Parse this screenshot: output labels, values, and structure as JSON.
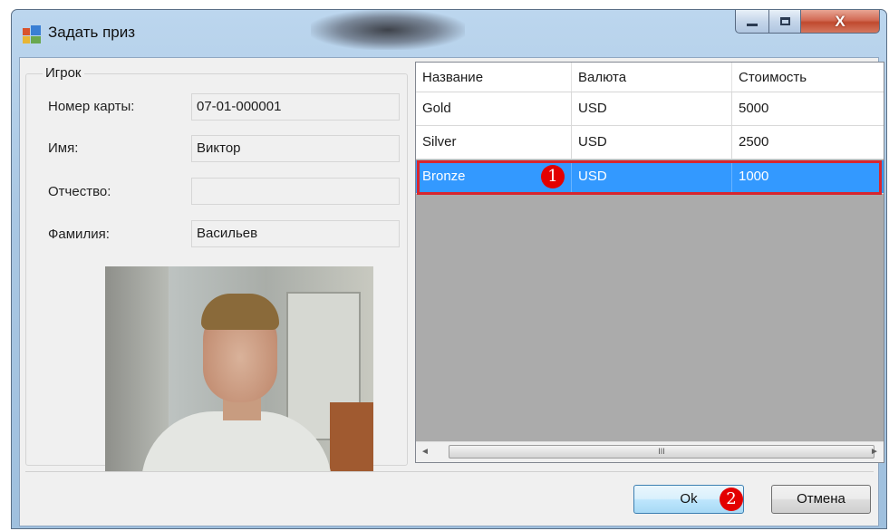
{
  "window": {
    "title": "Задать приз",
    "close_glyph": "X"
  },
  "player": {
    "group_title": "Игрок",
    "fields": [
      {
        "label": "Номер карты:",
        "value": "07-01-000001"
      },
      {
        "label": "Имя:",
        "value": "Виктор"
      },
      {
        "label": "Отчество:",
        "value": ""
      },
      {
        "label": "Фамилия:",
        "value": "Васильев"
      }
    ]
  },
  "prizes": {
    "columns": [
      "Название",
      "Валюта",
      "Стоимость"
    ],
    "rows": [
      {
        "name": "Gold",
        "currency": "USD",
        "cost": "5000"
      },
      {
        "name": "Silver",
        "currency": "USD",
        "cost": "2500"
      },
      {
        "name": "Bronze",
        "currency": "USD",
        "cost": "1000"
      }
    ],
    "selected_row": 2,
    "scroll_thumb_glyph": "III"
  },
  "markers": {
    "m1": "1",
    "m2": "2"
  },
  "buttons": {
    "ok": "Ok",
    "cancel": "Отмена"
  },
  "colors": {
    "selection": "#3399ff",
    "highlight_border": "#d8262e",
    "marker": "#e30000"
  }
}
